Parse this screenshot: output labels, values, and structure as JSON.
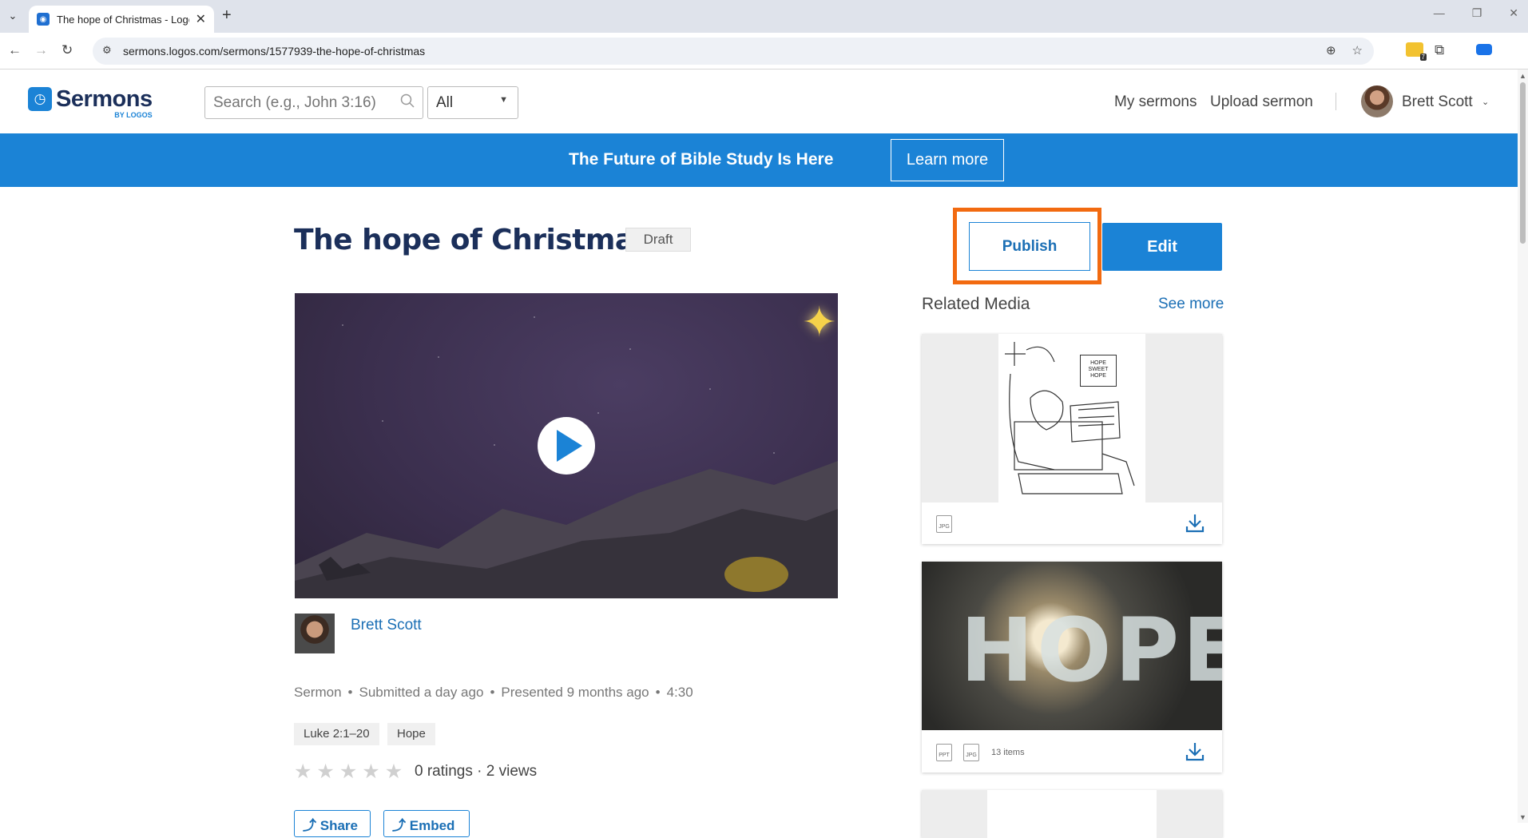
{
  "browser": {
    "tab_title": "The hope of Christmas - Logos",
    "url": "sermons.logos.com/sermons/1577939-the-hope-of-christmas",
    "extension_badge": "7"
  },
  "header": {
    "logo_word": "Sermons",
    "logo_sub": "BY LOGOS",
    "search_placeholder": "Search (e.g., John 3:16)",
    "filter_value": "All",
    "links": {
      "my_sermons": "My sermons",
      "upload": "Upload sermon"
    },
    "user_name": "Brett Scott"
  },
  "banner": {
    "text": "The Future of Bible Study Is Here",
    "button": "Learn more"
  },
  "sermon": {
    "title": "The hope of Christmas",
    "status": "Draft",
    "publish_label": "Publish",
    "edit_label": "Edit",
    "author": "Brett Scott",
    "meta": [
      "Sermon",
      "•",
      "Submitted a day ago",
      "•",
      "Presented 9 months ago",
      "•",
      "4:30"
    ],
    "tags": [
      "Luke 2:1–20",
      "Hope"
    ],
    "rating_stars": 0,
    "ratings_text": "0 ratings · 2 views",
    "actions": [
      "Share",
      "Embed"
    ]
  },
  "related": {
    "title": "Related Media",
    "see_more": "See more",
    "cards": [
      {
        "types": [
          "JPG"
        ],
        "count": "",
        "sign_text": "HOPE SWEET HOPE"
      },
      {
        "types": [
          "PPT",
          "JPG"
        ],
        "count": "13 items",
        "image_text": "HOPE"
      }
    ]
  },
  "colors": {
    "brand_blue": "#1b83d6",
    "navy": "#1b2f5a",
    "highlight": "#f26a10"
  }
}
